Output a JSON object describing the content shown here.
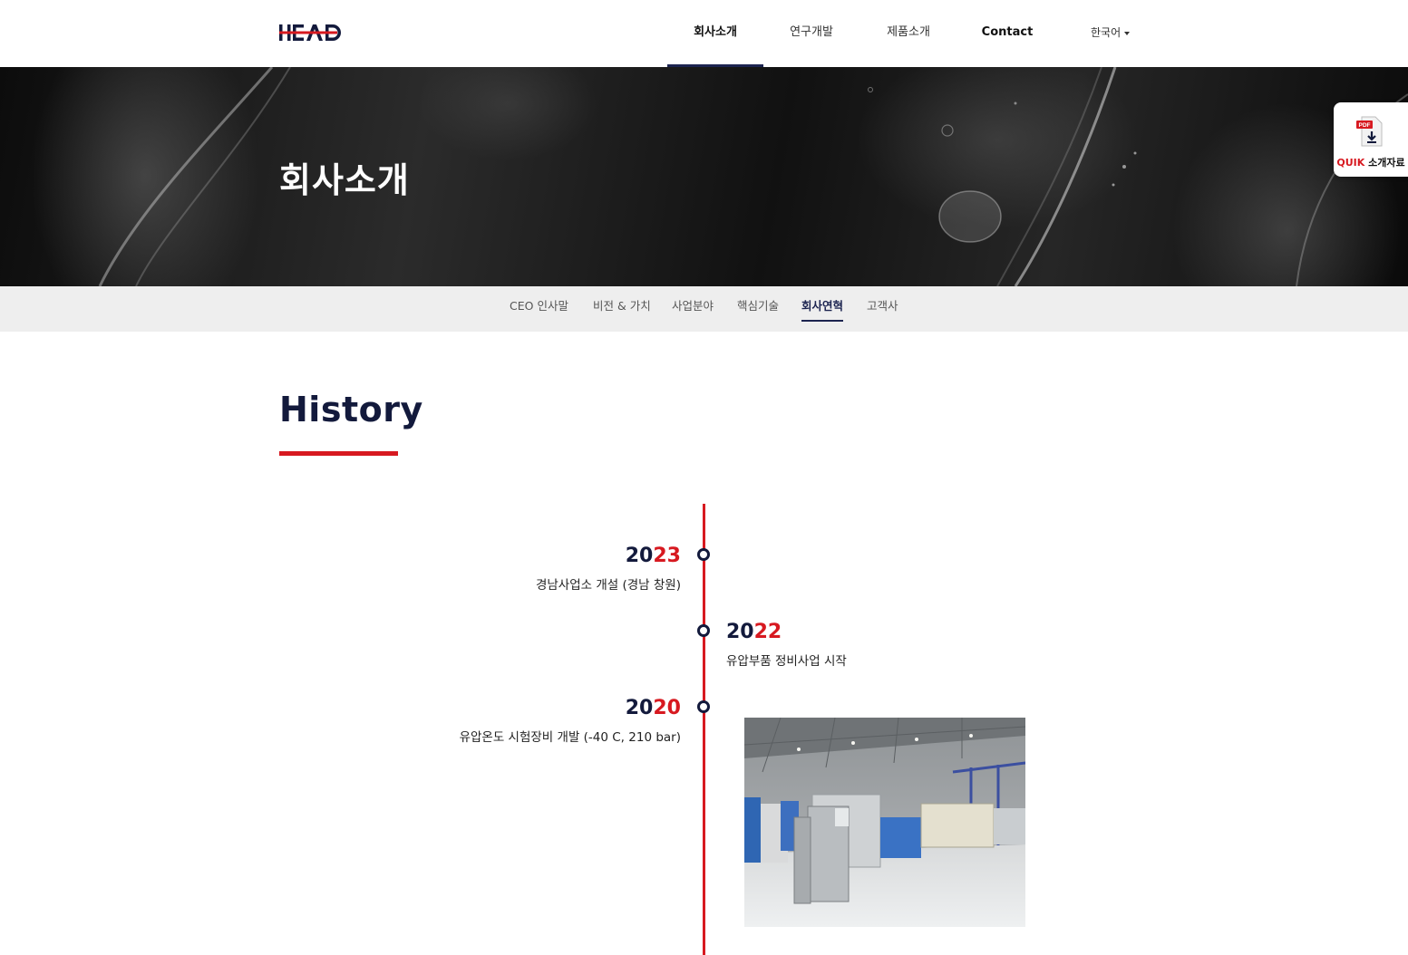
{
  "header": {
    "logo_text": "HEAD",
    "nav": [
      {
        "label": "회사소개",
        "active": true
      },
      {
        "label": "연구개발",
        "active": false
      },
      {
        "label": "제품소개",
        "active": false
      },
      {
        "label": "Contact",
        "active": false
      }
    ],
    "language": "한국어"
  },
  "hero": {
    "title": "회사소개"
  },
  "quick": {
    "badge": "PDF",
    "label_brand": "QUIK",
    "label_text": " 소개자료"
  },
  "subnav": [
    {
      "label": "CEO 인사말",
      "active": false
    },
    {
      "label": "비전 & 가치",
      "active": false
    },
    {
      "label": "사업분야",
      "active": false
    },
    {
      "label": "핵심기술",
      "active": false
    },
    {
      "label": "회사연혁",
      "active": true
    },
    {
      "label": "고객사",
      "active": false
    }
  ],
  "history": {
    "title": "History",
    "entries": [
      {
        "year_prefix": "20",
        "year_suffix": "23",
        "text": "경남사업소 개설 (경남 창원)",
        "side": "left"
      },
      {
        "year_prefix": "20",
        "year_suffix": "22",
        "text": "유압부품 정비사업 시작",
        "side": "right"
      },
      {
        "year_prefix": "20",
        "year_suffix": "20",
        "text": "유압온도 시험장비 개발 (-40 C, 210 bar)",
        "side": "left"
      }
    ]
  },
  "colors": {
    "navy": "#131a3c",
    "accent_red": "#d71920",
    "subnav_bg": "#eeeeee"
  }
}
